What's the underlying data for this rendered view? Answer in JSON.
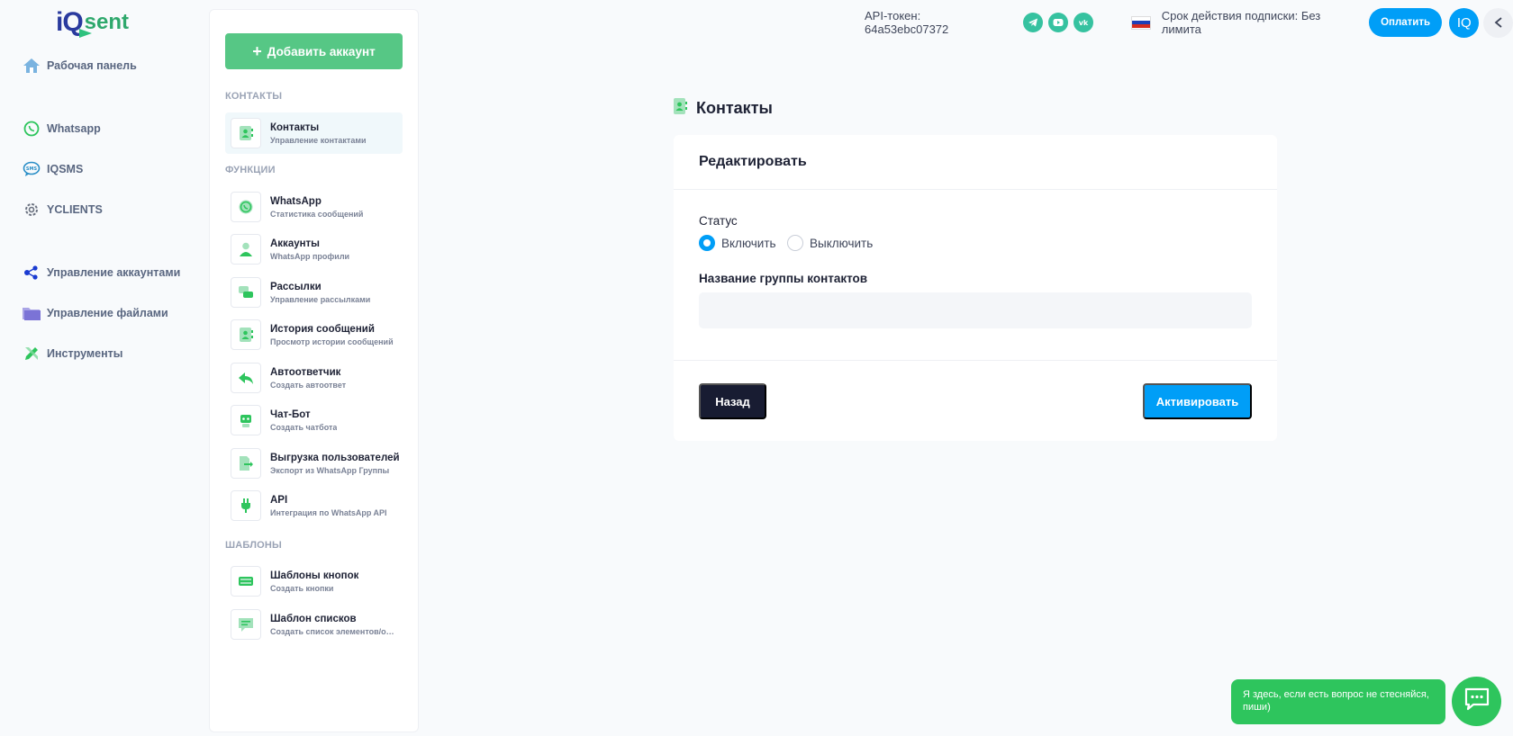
{
  "logo": {
    "part1": "iQ",
    "part2": "sent"
  },
  "nav": {
    "dashboard": "Рабочая панель",
    "whatsapp": "Whatsapp",
    "iqsms": "IQSMS",
    "yclients": "YCLIENTS",
    "accounts": "Управление аккаунтами",
    "files": "Управление файлами",
    "tools": "Инструменты"
  },
  "sidebar": {
    "add_button": "Добавить аккаунт",
    "section_contacts": "КОНТАКТЫ",
    "section_functions": "ФУНКЦИИ",
    "section_templates": "ШАБЛОНЫ",
    "contacts": {
      "title": "Контакты",
      "sub": "Управление контактами"
    },
    "functions": [
      {
        "title": "WhatsApp",
        "sub": "Статистика сообщений"
      },
      {
        "title": "Аккаунты",
        "sub": "WhatsApp профили"
      },
      {
        "title": "Рассылки",
        "sub": "Управление рассылками"
      },
      {
        "title": "История сообщений",
        "sub": "Просмотр истории сообщений"
      },
      {
        "title": "Автоответчик",
        "sub": "Создать автоответ"
      },
      {
        "title": "Чат-Бот",
        "sub": "Создать чатбота"
      },
      {
        "title": "Выгрузка пользователей",
        "sub": "Экспорт из WhatsApp Группы"
      },
      {
        "title": "API",
        "sub": "Интеграция по WhatsApp API"
      }
    ],
    "templates": [
      {
        "title": "Шаблоны кнопок",
        "sub": "Создать кнопки"
      },
      {
        "title": "Шаблон списков",
        "sub": "Создать список элементов/опц..."
      }
    ]
  },
  "topbar": {
    "api_token": "API-токен: 64a53ebc07372",
    "subscription": "Срок действия подписки: Без лимита",
    "pay_button": "Оплатить",
    "avatar": "IQ"
  },
  "page": {
    "title": "Контакты",
    "card_title": "Редактировать",
    "status_label": "Статус",
    "radio_on": "Включить",
    "radio_off": "Выключить",
    "group_label": "Название группы контактов",
    "group_value": "",
    "back_button": "Назад",
    "activate_button": "Активировать"
  },
  "chat": {
    "bubble": "Я здесь, если есть вопрос не стесняйся, пиши)"
  },
  "colors": {
    "accent": "#009ef7",
    "green": "#56c785",
    "dark": "#181c32"
  }
}
